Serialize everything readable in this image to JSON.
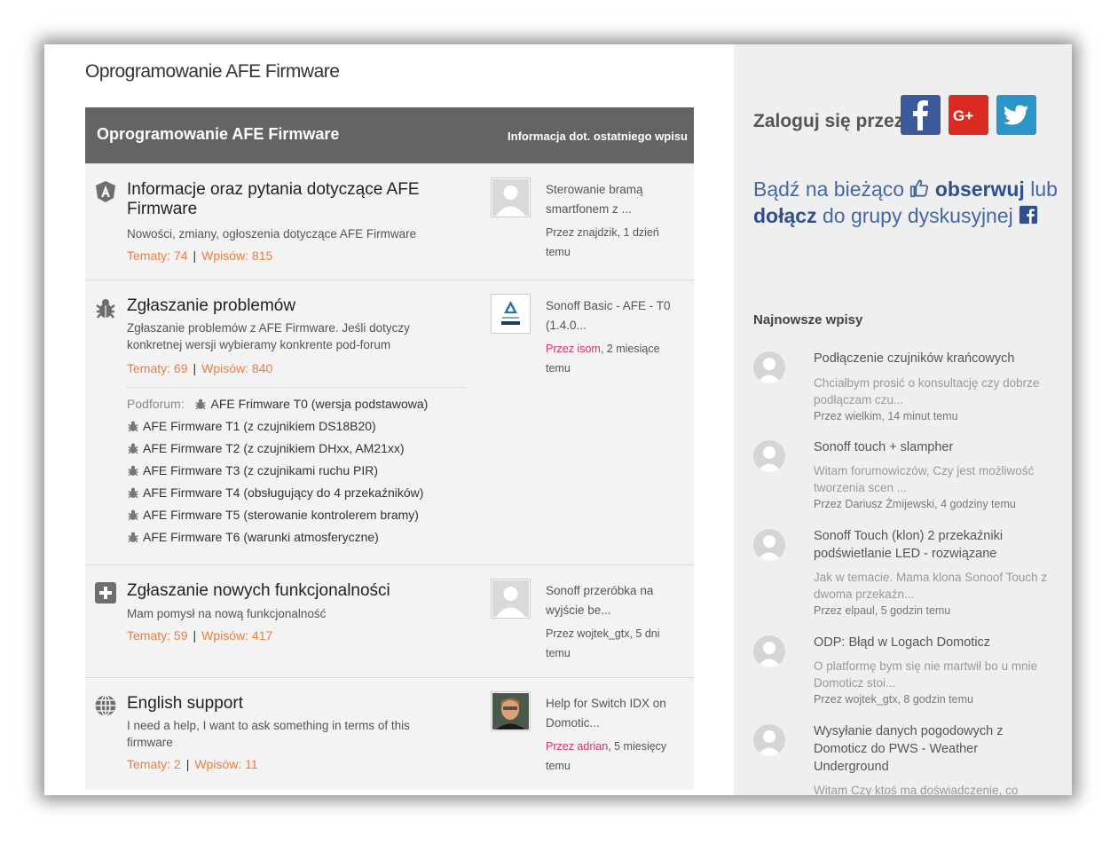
{
  "page": {
    "title": "Oprogramowanie AFE Firmware"
  },
  "forum_header": {
    "title": "Oprogramowanie AFE Firmware",
    "last_post_label": "Informacja dot. ostatniego wpisu"
  },
  "forums": [
    {
      "icon": "afe-logo-icon",
      "title": "Informacje oraz pytania dotyczące AFE Firmware",
      "description": "Nowości, zmiany, ogłoszenia dotyczące AFE Firmware",
      "topics": "Tematy: 74",
      "posts": "Wpisów: 815",
      "last_post": {
        "title": "Sterowanie bramą smartfonem z ...",
        "meta_prefix": "Przez znajdzik, 1 dzień temu",
        "author": ""
      }
    },
    {
      "icon": "bug-icon",
      "title": "Zgłaszanie problemów",
      "description": "Zgłaszanie problemów z AFE Firmware. Jeśli dotyczy konkretnej wersji wybieramy konkrente pod-forum",
      "topics": "Tematy: 69",
      "posts": "Wpisów: 840",
      "subforum_label": "Podforum:",
      "subforums": [
        "AFE Frimware T0 (wersja podstawowa)",
        "AFE Firmware T1 (z czujnikiem DS18B20)",
        "AFE Firmware T2 (z czujnikiem DHxx, AM21xx)",
        "AFE Firmware T3 (z czujnikami ruchu PIR)",
        "AFE Firmware T4 (obsługujący do 4 przekaźników)",
        "AFE Firmware T5 (sterowanie kontrolerem bramy)",
        "AFE Firmware T6 (warunki atmosferyczne)"
      ],
      "last_post": {
        "title": "Sonoff Basic - AFE - T0 (1.4.0...",
        "author": "Przez isom",
        "meta_suffix": ", 2 miesiące temu"
      }
    },
    {
      "icon": "plus-icon",
      "title": "Zgłaszanie nowych funkcjonalności",
      "description": "Mam pomysł na nową funkcjonalność",
      "topics": "Tematy: 59",
      "posts": "Wpisów: 417",
      "last_post": {
        "title": "Sonoff przeróbka na wyjście be...",
        "meta_prefix": "Przez wojtek_gtx, 5 dni temu",
        "author": ""
      }
    },
    {
      "icon": "globe-icon",
      "title": "English support",
      "description": "I need a help, I want to ask something in terms of this firmware",
      "topics": "Tematy: 2",
      "posts": "Wpisów: 11",
      "last_post": {
        "title": "Help for Switch IDX on Domotic...",
        "author": "Przez adrian",
        "meta_suffix": ", 5 miesięcy temu"
      }
    }
  ],
  "sidebar": {
    "login_label": "Zaloguj się przez",
    "social": [
      "facebook-icon",
      "google-plus-icon",
      "twitter-icon"
    ],
    "follow": {
      "part1": "Bądź na bieżąco ",
      "obserwuj": "obserwuj",
      "lub": " lub",
      "dolacz": "dołącz",
      "part2": " do grupy dyskusyjnej "
    },
    "latest_heading": "Najnowsze wpisy",
    "latest": [
      {
        "title": "Podłączenie czujników krańcowych",
        "excerpt": "Chciałbym prosić o konsultację czy dobrze podłączam czu...",
        "meta": "Przez wielkim, 14 minut temu"
      },
      {
        "title": "Sonoff touch + slampher",
        "excerpt": "Witam forumowiczów,  Czy jest możliwość tworzenia scen ...",
        "meta": "Przez Dariusz Żmijewski, 4 godziny temu"
      },
      {
        "title": "Sonoff Touch (klon) 2 przekaźniki podświetlanie LED - rozwiązane",
        "excerpt": "Jak w temacie. Mama klona Sonoof Touch z dwoma przekaźn...",
        "meta": "Przez elpaul, 5 godzin temu"
      },
      {
        "title": "ODP: Błąd w Logach Domoticz",
        "excerpt": "O platformę bym się nie martwił bo u mnie Domoticz stoi...",
        "meta": "Przez wojtek_gtx, 8 godzin temu"
      },
      {
        "title": "Wysyłanie danych pogodowych z Domoticz do PWS - Weather Underground",
        "excerpt": "Witam Czy ktoś ma doświadczenie, co",
        "meta": ""
      }
    ]
  },
  "colors": {
    "header_bg": "#646464",
    "stats_orange": "#f07b3e",
    "link_pink": "#d3306e",
    "follow_blue": "#4268a6",
    "facebook": "#3c5a99",
    "google": "#db2a22",
    "twitter": "#2b95c7"
  }
}
